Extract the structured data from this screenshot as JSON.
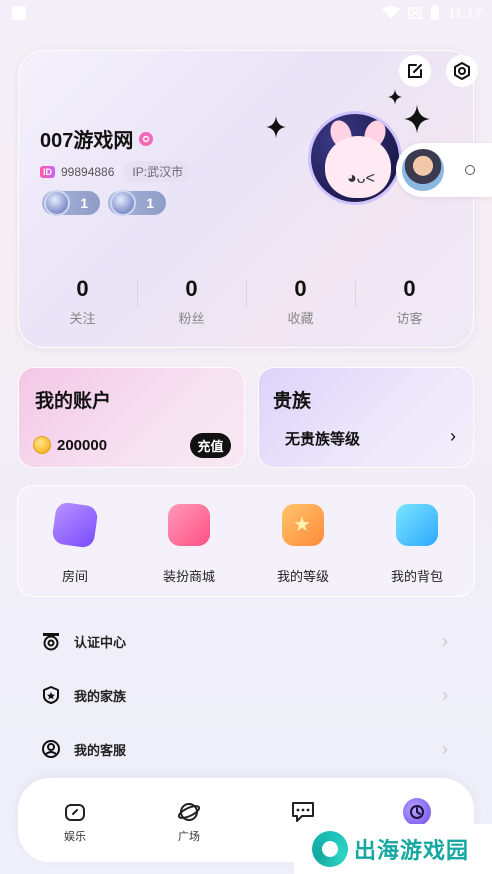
{
  "status_bar": {
    "time": "11:17"
  },
  "profile": {
    "username": "007游戏网",
    "id_badge": "ID",
    "id": "99894886",
    "ip": "IP:武汉市",
    "levels": [
      {
        "value": "1"
      },
      {
        "value": "1"
      }
    ],
    "stats": [
      {
        "value": "0",
        "label": "关注"
      },
      {
        "value": "0",
        "label": "粉丝"
      },
      {
        "value": "0",
        "label": "收藏"
      },
      {
        "value": "0",
        "label": "访客"
      }
    ]
  },
  "account": {
    "title": "我的账户",
    "balance": "200000",
    "recharge_label": "充值"
  },
  "noble": {
    "title": "贵族",
    "level": "无贵族等级",
    "chevron": "›"
  },
  "features": [
    {
      "label": "房间",
      "icon": "room-icon"
    },
    {
      "label": "装扮商城",
      "icon": "shop-bag-icon"
    },
    {
      "label": "我的等级",
      "icon": "star-level-icon"
    },
    {
      "label": "我的背包",
      "icon": "backpack-icon"
    }
  ],
  "menu": [
    {
      "label": "认证中心",
      "icon": "certification-icon"
    },
    {
      "label": "我的家族",
      "icon": "family-icon"
    },
    {
      "label": "我的客服",
      "icon": "customer-service-icon"
    }
  ],
  "tabs": [
    {
      "label": "娱乐",
      "icon": "entertainment-icon"
    },
    {
      "label": "广场",
      "icon": "planet-icon"
    },
    {
      "label": "",
      "icon": "chat-icon"
    },
    {
      "label": "",
      "icon": "profile-icon"
    }
  ],
  "watermark": {
    "text": "出海游戏园"
  },
  "colors": {
    "accent_purple": "#7a4cff",
    "badge_pink": "#f26ab7",
    "watermark_teal": "#14a8a0"
  }
}
